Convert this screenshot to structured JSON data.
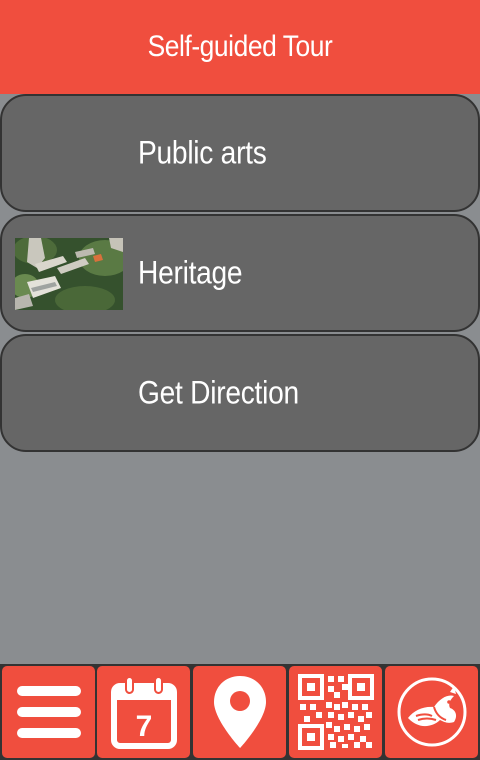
{
  "header": {
    "title": "Self-guided Tour"
  },
  "menu": {
    "items": [
      {
        "label": "Public arts",
        "icon": "none"
      },
      {
        "label": "Heritage",
        "icon": "aerial-campus-photo"
      },
      {
        "label": "Get Direction",
        "icon": "none"
      }
    ]
  },
  "tabbar": {
    "calendar_day": "7",
    "tabs": [
      {
        "icon": "hamburger-menu-icon"
      },
      {
        "icon": "calendar-icon"
      },
      {
        "icon": "map-pin-icon"
      },
      {
        "icon": "qr-code-icon"
      },
      {
        "icon": "logo-emblem-icon"
      }
    ]
  },
  "colors": {
    "accent": "#f04e3e",
    "background": "#8a8d90",
    "item_background": "#666666",
    "item_border": "#333333",
    "text": "#ffffff"
  }
}
